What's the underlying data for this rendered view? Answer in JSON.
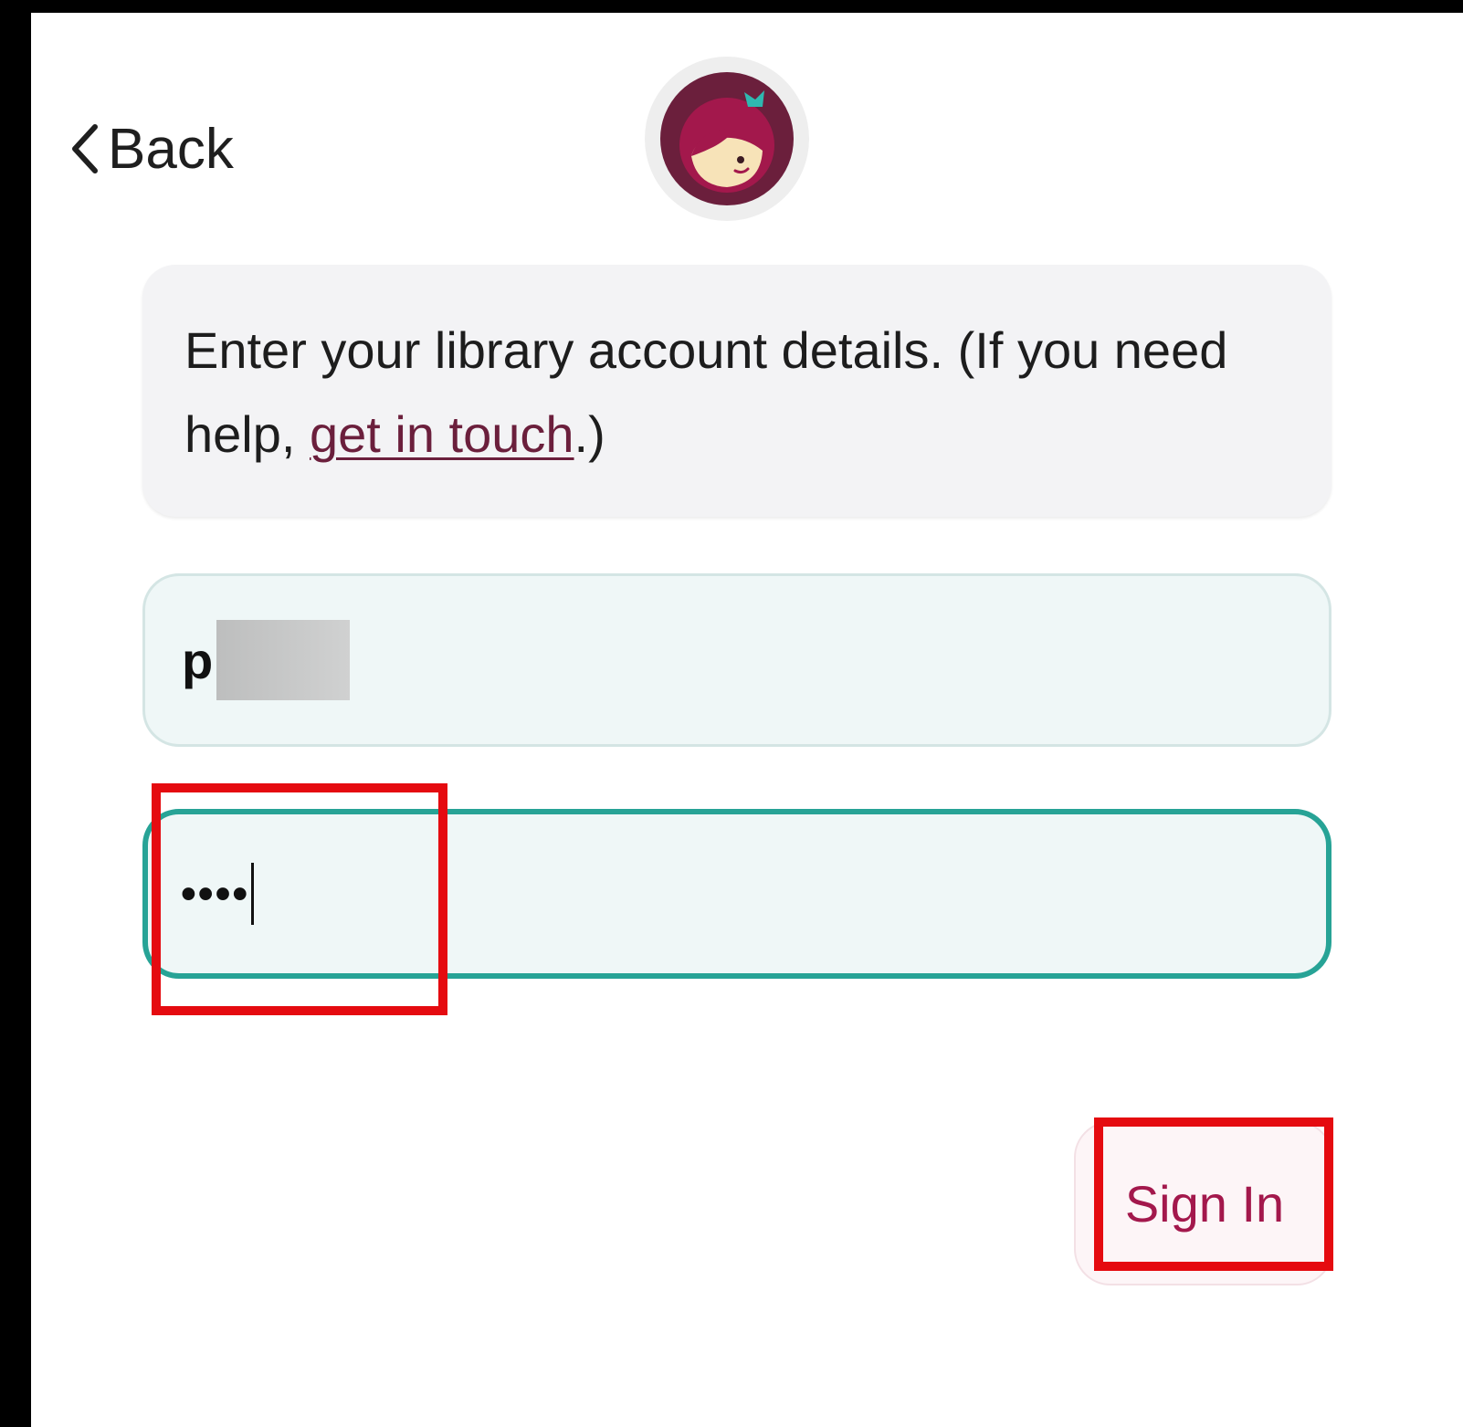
{
  "header": {
    "back_label": "Back",
    "back_icon": "chevron-left-icon",
    "logo_icon": "libby-logo-icon"
  },
  "info": {
    "text_before": "Enter your library account details. (If you need help, ",
    "link_text": "get in touch",
    "text_after": ".)"
  },
  "form": {
    "username_value": "p",
    "username_redacted": true,
    "password_value": "••••",
    "password_focused": true
  },
  "actions": {
    "sign_in_label": "Sign In"
  },
  "colors": {
    "accent_teal": "#27a396",
    "brand_maroon": "#6b1f3c",
    "sign_in_text": "#a3184c",
    "highlight_red": "#e50b10"
  }
}
